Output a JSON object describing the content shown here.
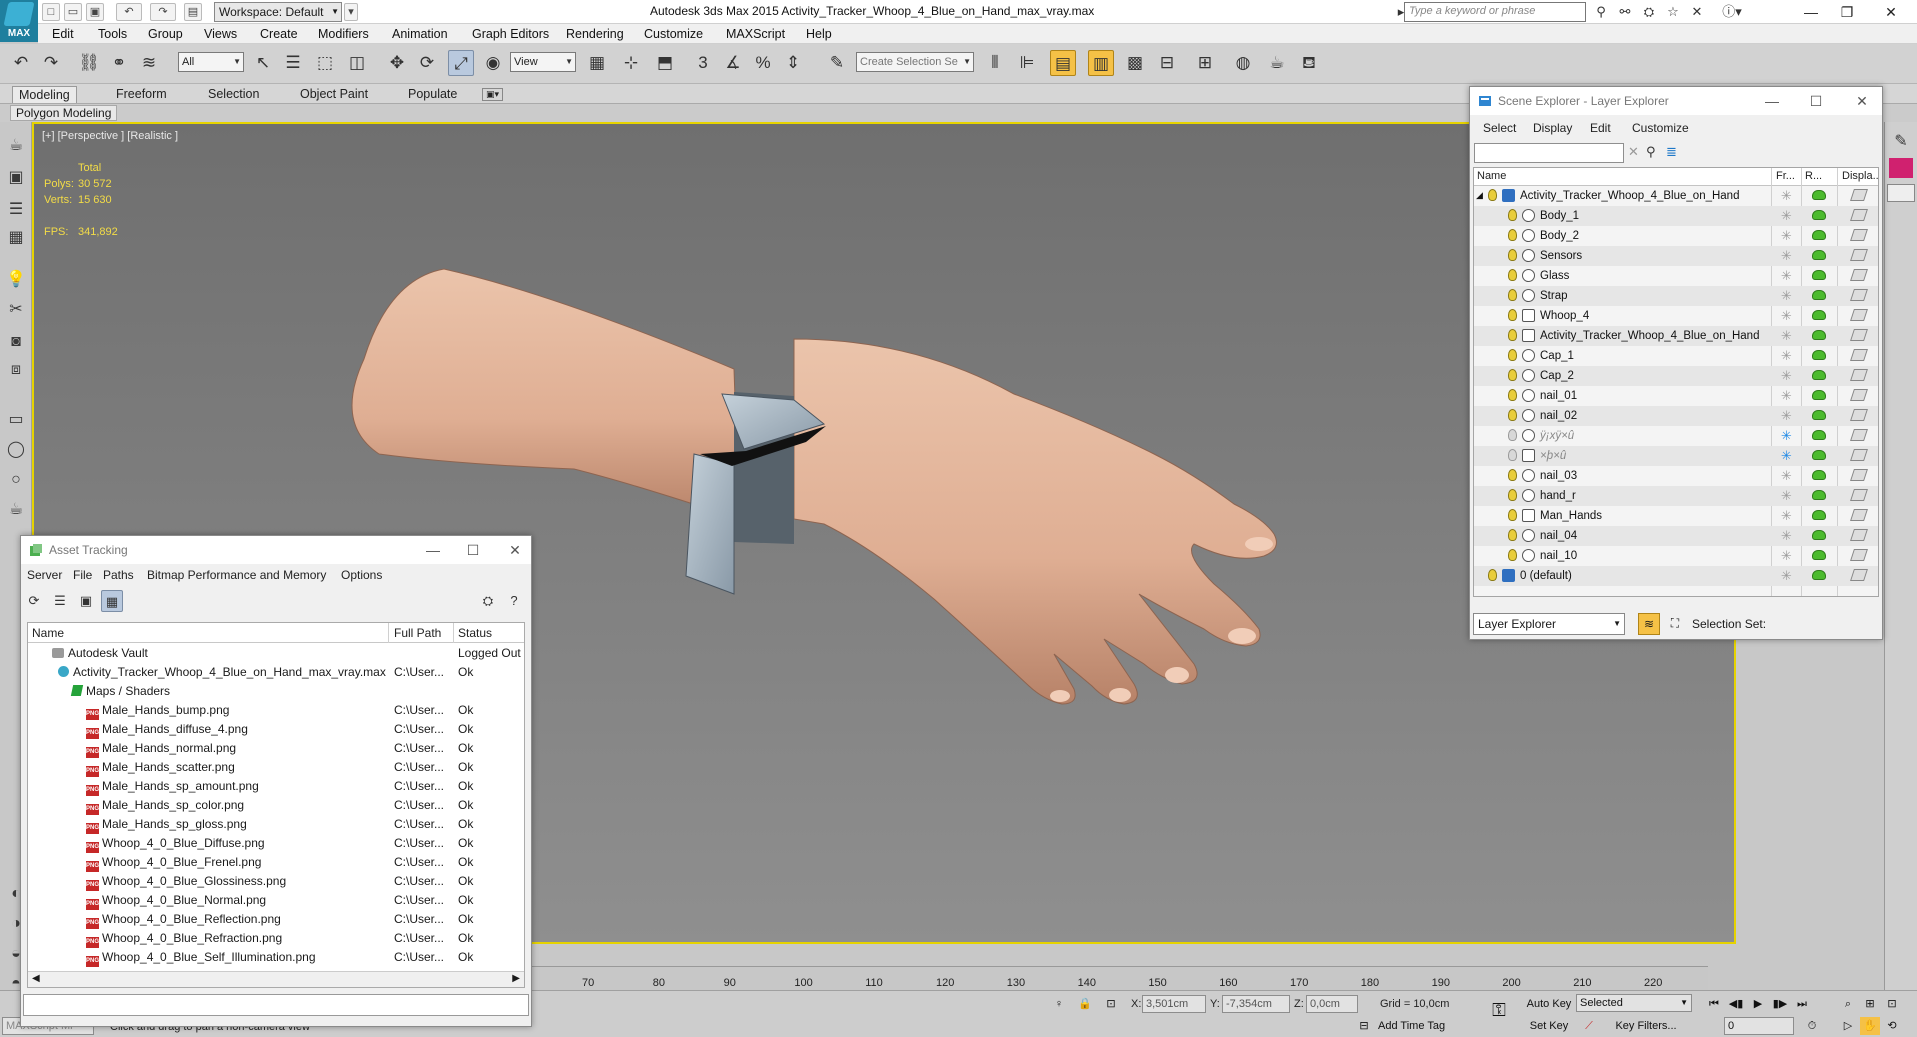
{
  "titlebar": {
    "app_logo_label": "MAX",
    "workspace": "Workspace: Default",
    "title": "Autodesk 3ds Max  2015    Activity_Tracker_Whoop_4_Blue_on_Hand_max_vray.max",
    "search_placeholder": "Type a keyword or phrase"
  },
  "menu": [
    "Edit",
    "Tools",
    "Group",
    "Views",
    "Create",
    "Modifiers",
    "Animation",
    "Graph Editors",
    "Rendering",
    "Customize",
    "MAXScript",
    "Help"
  ],
  "toolbar": {
    "filter": "All",
    "refcoord": "View",
    "selection_set_placeholder": "Create Selection Se"
  },
  "ribbon": {
    "tabs": [
      "Modeling",
      "Freeform",
      "Selection",
      "Object Paint",
      "Populate"
    ],
    "active_tab": "Modeling",
    "subtab": "Polygon Modeling"
  },
  "viewport": {
    "label": "[+] [Perspective ] [Realistic ]",
    "stats": {
      "total_label": "Total",
      "polys_label": "Polys:",
      "polys": "30 572",
      "verts_label": "Verts:",
      "verts": "15 630",
      "fps_label": "FPS:",
      "fps": "341,892"
    }
  },
  "asset_tracking": {
    "title": "Asset Tracking",
    "menu": [
      "Server",
      "File",
      "Paths",
      "Bitmap Performance and Memory",
      "Options"
    ],
    "columns": [
      "Name",
      "Full Path",
      "Status"
    ],
    "rows": [
      {
        "name": "Autodesk Vault",
        "path": "",
        "status": "Logged Out ..",
        "kind": "vault",
        "indent": 0
      },
      {
        "name": "Activity_Tracker_Whoop_4_Blue_on_Hand_max_vray.max",
        "path": "C:\\User...",
        "status": "Ok",
        "kind": "max",
        "indent": 1
      },
      {
        "name": "Maps / Shaders",
        "path": "",
        "status": "",
        "kind": "maps",
        "indent": 2
      },
      {
        "name": "Male_Hands_bump.png",
        "path": "C:\\User...",
        "status": "Ok",
        "kind": "file",
        "indent": 3
      },
      {
        "name": "Male_Hands_diffuse_4.png",
        "path": "C:\\User...",
        "status": "Ok",
        "kind": "file",
        "indent": 3
      },
      {
        "name": "Male_Hands_normal.png",
        "path": "C:\\User...",
        "status": "Ok",
        "kind": "file",
        "indent": 3
      },
      {
        "name": "Male_Hands_scatter.png",
        "path": "C:\\User...",
        "status": "Ok",
        "kind": "file",
        "indent": 3
      },
      {
        "name": "Male_Hands_sp_amount.png",
        "path": "C:\\User...",
        "status": "Ok",
        "kind": "file",
        "indent": 3
      },
      {
        "name": "Male_Hands_sp_color.png",
        "path": "C:\\User...",
        "status": "Ok",
        "kind": "file",
        "indent": 3
      },
      {
        "name": "Male_Hands_sp_gloss.png",
        "path": "C:\\User...",
        "status": "Ok",
        "kind": "file",
        "indent": 3
      },
      {
        "name": "Whoop_4_0_Blue_Diffuse.png",
        "path": "C:\\User...",
        "status": "Ok",
        "kind": "file",
        "indent": 3
      },
      {
        "name": "Whoop_4_0_Blue_Frenel.png",
        "path": "C:\\User...",
        "status": "Ok",
        "kind": "file",
        "indent": 3
      },
      {
        "name": "Whoop_4_0_Blue_Glossiness.png",
        "path": "C:\\User...",
        "status": "Ok",
        "kind": "file",
        "indent": 3
      },
      {
        "name": "Whoop_4_0_Blue_Normal.png",
        "path": "C:\\User...",
        "status": "Ok",
        "kind": "file",
        "indent": 3
      },
      {
        "name": "Whoop_4_0_Blue_Reflection.png",
        "path": "C:\\User...",
        "status": "Ok",
        "kind": "file",
        "indent": 3
      },
      {
        "name": "Whoop_4_0_Blue_Refraction.png",
        "path": "C:\\User...",
        "status": "Ok",
        "kind": "file",
        "indent": 3
      },
      {
        "name": "Whoop_4_0_Blue_Self_Illumination.png",
        "path": "C:\\User...",
        "status": "Ok",
        "kind": "file",
        "indent": 3
      }
    ]
  },
  "scene_explorer": {
    "title": "Scene Explorer - Layer Explorer",
    "menu": [
      "Select",
      "Display",
      "Edit",
      "Customize"
    ],
    "columns": [
      "Name",
      "Fr...",
      "R...",
      "Displa..."
    ],
    "rows": [
      {
        "name": "Activity_Tracker_Whoop_4_Blue_on_Hand",
        "level": 0,
        "type": "layer",
        "frozen": false,
        "dim": false
      },
      {
        "name": "Body_1",
        "level": 1,
        "type": "object",
        "frozen": false,
        "dim": false
      },
      {
        "name": "Body_2",
        "level": 1,
        "type": "object",
        "frozen": false,
        "dim": false
      },
      {
        "name": "Sensors",
        "level": 1,
        "type": "object",
        "frozen": false,
        "dim": false
      },
      {
        "name": "Glass",
        "level": 1,
        "type": "object",
        "frozen": false,
        "dim": false
      },
      {
        "name": "Strap",
        "level": 1,
        "type": "object",
        "frozen": false,
        "dim": false
      },
      {
        "name": "Whoop_4",
        "level": 1,
        "type": "group",
        "frozen": false,
        "dim": false
      },
      {
        "name": "Activity_Tracker_Whoop_4_Blue_on_Hand",
        "level": 1,
        "type": "group",
        "frozen": false,
        "dim": false
      },
      {
        "name": "Cap_1",
        "level": 1,
        "type": "object",
        "frozen": false,
        "dim": false
      },
      {
        "name": "Cap_2",
        "level": 1,
        "type": "object",
        "frozen": false,
        "dim": false
      },
      {
        "name": "nail_01",
        "level": 1,
        "type": "object",
        "frozen": false,
        "dim": false
      },
      {
        "name": "nail_02",
        "level": 1,
        "type": "object",
        "frozen": false,
        "dim": false
      },
      {
        "name": "ÿ¡xÿ×û",
        "level": 1,
        "type": "object",
        "frozen": true,
        "dim": true
      },
      {
        "name": "×þ×û",
        "level": 1,
        "type": "group",
        "frozen": true,
        "dim": true
      },
      {
        "name": "nail_03",
        "level": 1,
        "type": "object",
        "frozen": false,
        "dim": false
      },
      {
        "name": "hand_r",
        "level": 1,
        "type": "object",
        "frozen": false,
        "dim": false
      },
      {
        "name": "Man_Hands",
        "level": 1,
        "type": "group",
        "frozen": false,
        "dim": false
      },
      {
        "name": "nail_04",
        "level": 1,
        "type": "object",
        "frozen": false,
        "dim": false
      },
      {
        "name": "nail_10",
        "level": 1,
        "type": "object",
        "frozen": false,
        "dim": false
      },
      {
        "name": "0 (default)",
        "level": 0,
        "type": "layer",
        "frozen": false,
        "dim": false
      }
    ],
    "footer_combo": "Layer Explorer",
    "selection_set_label": "Selection Set:"
  },
  "timeline": {
    "ticks": [
      "70",
      "80",
      "90",
      "100",
      "110",
      "120",
      "130",
      "140",
      "150",
      "160",
      "170",
      "180",
      "190",
      "200",
      "210",
      "220"
    ]
  },
  "status": {
    "maxscript": "MAXScript Mi",
    "prompt": "Click and drag to pan a non-camera view",
    "x_label": "X:",
    "x": "3,501cm",
    "y_label": "Y:",
    "y": "-7,354cm",
    "z_label": "Z:",
    "z": "0,0cm",
    "grid": "Grid = 10,0cm",
    "add_time_tag": "Add Time Tag",
    "auto_key": "Auto Key",
    "set_key": "Set Key",
    "selected": "Selected",
    "key_filters": "Key Filters...",
    "frame": "0"
  },
  "colors": {
    "viewport_border": "#e6d300",
    "stat_text": "#f3dc47",
    "skin": "#e3b49a",
    "strap": "#a7b6c3",
    "logo": "#1f7f9e"
  }
}
